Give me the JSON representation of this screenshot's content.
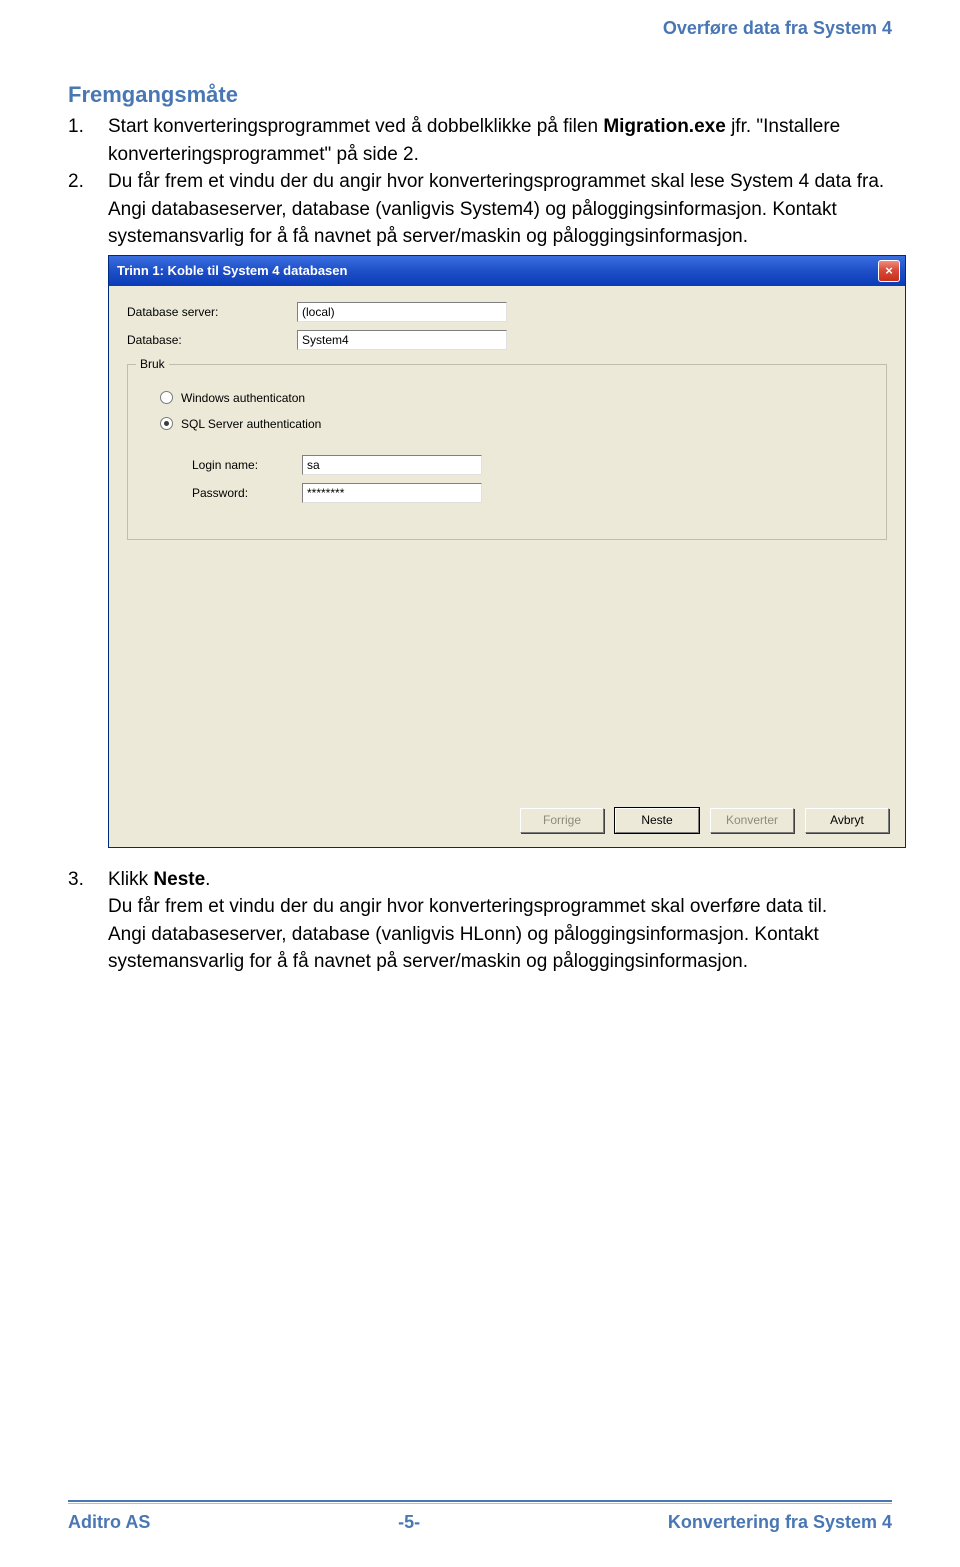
{
  "header": {
    "title": "Overføre data fra System 4"
  },
  "section_heading": "Fremgangsmåte",
  "step1": {
    "num": "1.",
    "text_a": "Start konverteringsprogrammet ved å dobbelklikke på filen ",
    "text_b": "Migration.exe",
    "text_c": " jfr. \"Installere konverteringsprogrammet\" på side 2."
  },
  "step2": {
    "num": "2.",
    "text_a": "Du får frem et vindu der du angir hvor konverteringsprogrammet skal lese System 4 data fra.",
    "text_b": "Angi databaseserver, database (vanligvis System4) og påloggingsinformasjon. Kontakt systemansvarlig for å få navnet på server/maskin og påloggingsinformasjon."
  },
  "dialog": {
    "title": "Trinn 1: Koble til System 4 databasen",
    "close": "×",
    "db_server_label": "Database server:",
    "db_server_value": "(local)",
    "database_label": "Database:",
    "database_value": "System4",
    "fieldset_legend": "Bruk",
    "radio_windows": "Windows authenticaton",
    "radio_sql": "SQL Server authentication",
    "login_label": "Login name:",
    "login_value": "sa",
    "password_label": "Password:",
    "password_value": "********",
    "btn_prev": "Forrige",
    "btn_next": "Neste",
    "btn_convert": "Konverter",
    "btn_cancel": "Avbryt"
  },
  "step3": {
    "num": "3.",
    "text_a": "Klikk ",
    "text_b": "Neste",
    "text_c": ".",
    "text_d": "Du får frem et vindu der du angir hvor konverteringsprogrammet skal overføre data til.",
    "text_e": "Angi databaseserver, database (vanligvis HLonn) og påloggingsinformasjon. Kontakt systemansvarlig for å få navnet på server/maskin og påloggingsinformasjon."
  },
  "footer": {
    "left": "Aditro AS",
    "center": "-5-",
    "right": "Konvertering fra System 4"
  }
}
